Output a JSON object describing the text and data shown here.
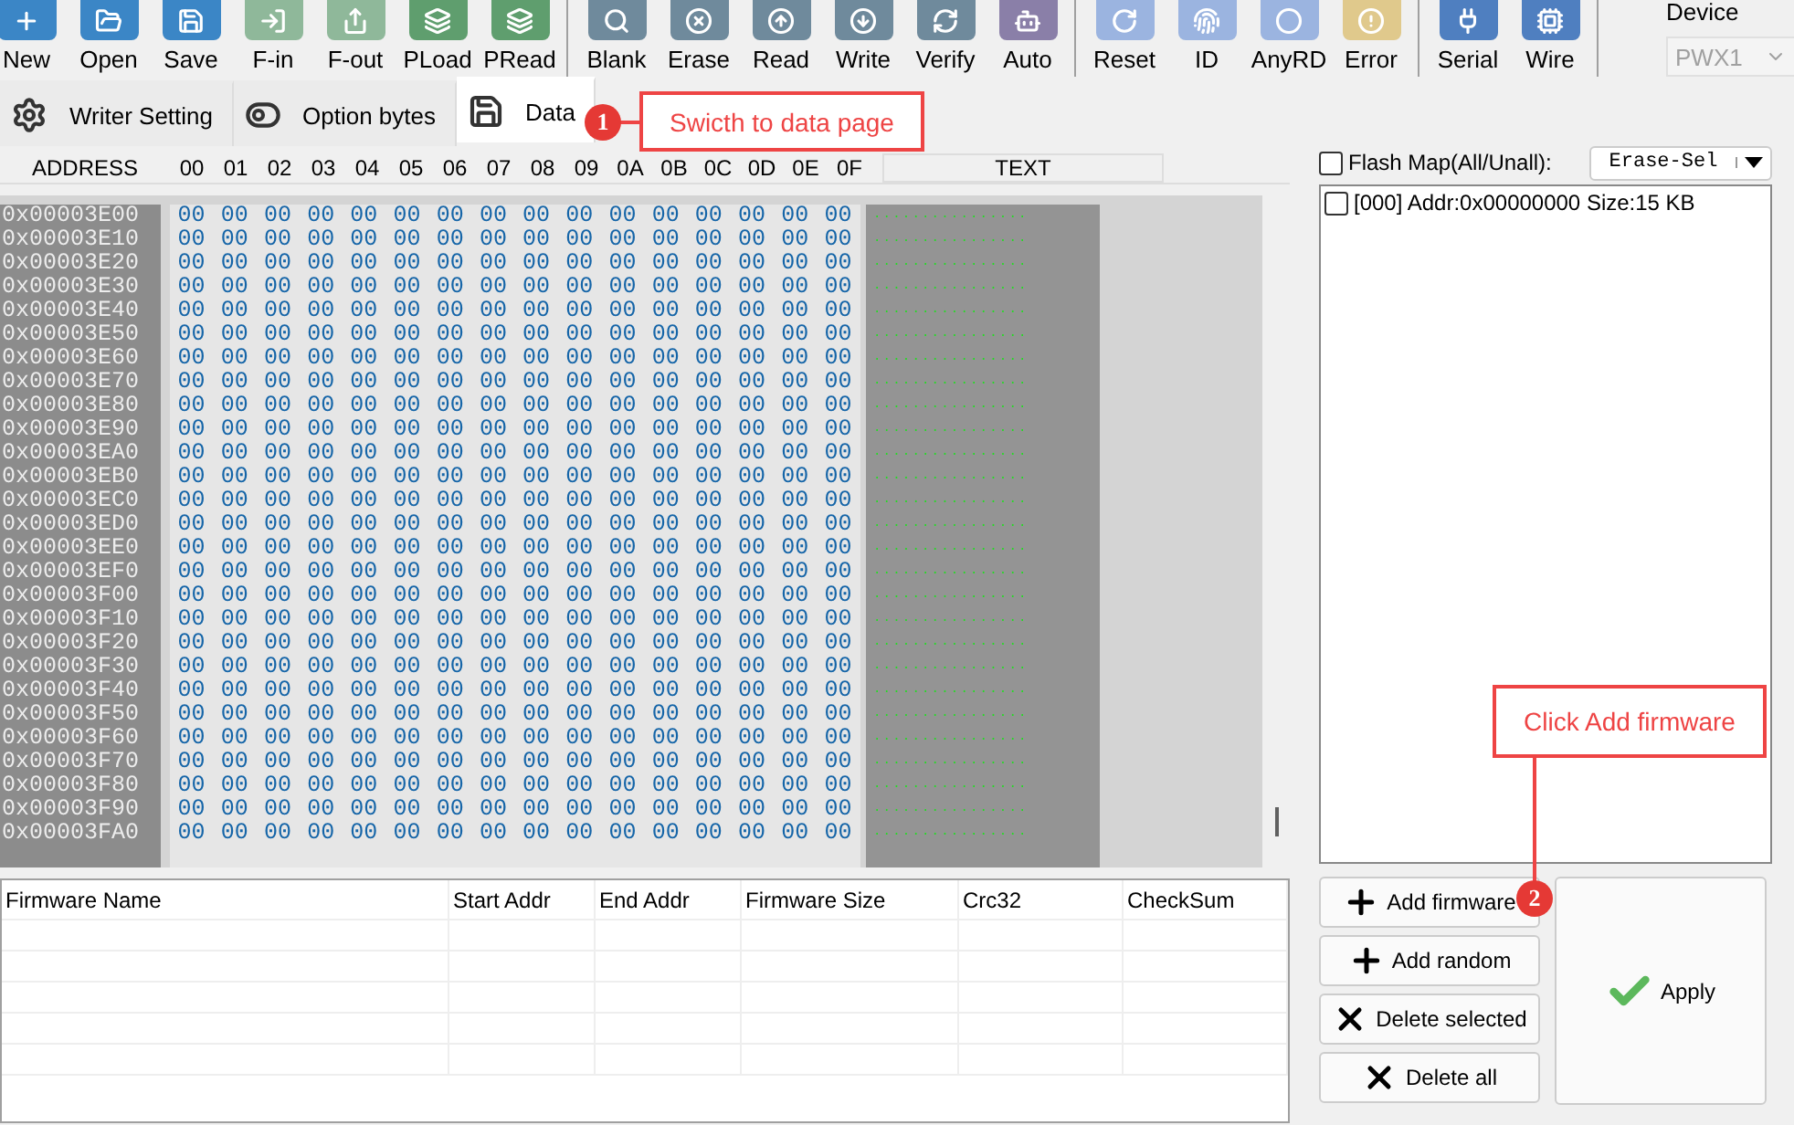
{
  "toolbar": {
    "groups": [
      [
        {
          "label": "New",
          "color": "#3b86c6"
        },
        {
          "label": "Open",
          "color": "#3b86c6"
        },
        {
          "label": "Save",
          "color": "#3b86c6"
        },
        {
          "label": "F-in",
          "color": "#8fb89a"
        },
        {
          "label": "F-out",
          "color": "#8fb89a"
        },
        {
          "label": "PLoad",
          "color": "#5f9e6e"
        },
        {
          "label": "PRead",
          "color": "#5f9e6e"
        }
      ],
      [
        {
          "label": "Blank",
          "color": "#6f8a9c"
        },
        {
          "label": "Erase",
          "color": "#6f8a9c"
        },
        {
          "label": "Read",
          "color": "#6f8a9c"
        },
        {
          "label": "Write",
          "color": "#6f8a9c"
        },
        {
          "label": "Verify",
          "color": "#6f8a9c"
        },
        {
          "label": "Auto",
          "color": "#8a7fa8"
        }
      ],
      [
        {
          "label": "Reset",
          "color": "#9bb4e0"
        },
        {
          "label": "ID",
          "color": "#9bb4e0"
        },
        {
          "label": "AnyRD",
          "color": "#9bb4e0"
        },
        {
          "label": "Error",
          "color": "#e0c98c"
        }
      ],
      [
        {
          "label": "Serial",
          "color": "#4f7fc0"
        },
        {
          "label": "Wire",
          "color": "#4f7fc0"
        }
      ]
    ],
    "device": {
      "label": "Device",
      "value": "PWX1",
      "disabled": true
    }
  },
  "tabs": [
    {
      "label": "Writer Setting",
      "selected": false
    },
    {
      "label": "Option bytes",
      "selected": false
    },
    {
      "label": "Data",
      "selected": true
    }
  ],
  "callouts": [
    {
      "number": "1",
      "text": "Swicth to data page"
    },
    {
      "number": "2",
      "text": "Click Add firmware"
    }
  ],
  "hex": {
    "columns": [
      "ADDRESS",
      "00",
      "01",
      "02",
      "03",
      "04",
      "05",
      "06",
      "07",
      "08",
      "09",
      "0A",
      "0B",
      "0C",
      "0D",
      "0E",
      "0F",
      "TEXT"
    ],
    "rows": [
      {
        "address": "0x00003E00",
        "bytes": [
          "00",
          "00",
          "00",
          "00",
          "00",
          "00",
          "00",
          "00",
          "00",
          "00",
          "00",
          "00",
          "00",
          "00",
          "00",
          "00"
        ],
        "text": "................"
      },
      {
        "address": "0x00003E10",
        "bytes": [
          "00",
          "00",
          "00",
          "00",
          "00",
          "00",
          "00",
          "00",
          "00",
          "00",
          "00",
          "00",
          "00",
          "00",
          "00",
          "00"
        ],
        "text": "................"
      },
      {
        "address": "0x00003E20",
        "bytes": [
          "00",
          "00",
          "00",
          "00",
          "00",
          "00",
          "00",
          "00",
          "00",
          "00",
          "00",
          "00",
          "00",
          "00",
          "00",
          "00"
        ],
        "text": "................"
      },
      {
        "address": "0x00003E30",
        "bytes": [
          "00",
          "00",
          "00",
          "00",
          "00",
          "00",
          "00",
          "00",
          "00",
          "00",
          "00",
          "00",
          "00",
          "00",
          "00",
          "00"
        ],
        "text": "................"
      },
      {
        "address": "0x00003E40",
        "bytes": [
          "00",
          "00",
          "00",
          "00",
          "00",
          "00",
          "00",
          "00",
          "00",
          "00",
          "00",
          "00",
          "00",
          "00",
          "00",
          "00"
        ],
        "text": "................"
      },
      {
        "address": "0x00003E50",
        "bytes": [
          "00",
          "00",
          "00",
          "00",
          "00",
          "00",
          "00",
          "00",
          "00",
          "00",
          "00",
          "00",
          "00",
          "00",
          "00",
          "00"
        ],
        "text": "................"
      },
      {
        "address": "0x00003E60",
        "bytes": [
          "00",
          "00",
          "00",
          "00",
          "00",
          "00",
          "00",
          "00",
          "00",
          "00",
          "00",
          "00",
          "00",
          "00",
          "00",
          "00"
        ],
        "text": "................"
      },
      {
        "address": "0x00003E70",
        "bytes": [
          "00",
          "00",
          "00",
          "00",
          "00",
          "00",
          "00",
          "00",
          "00",
          "00",
          "00",
          "00",
          "00",
          "00",
          "00",
          "00"
        ],
        "text": "................"
      },
      {
        "address": "0x00003E80",
        "bytes": [
          "00",
          "00",
          "00",
          "00",
          "00",
          "00",
          "00",
          "00",
          "00",
          "00",
          "00",
          "00",
          "00",
          "00",
          "00",
          "00"
        ],
        "text": "................"
      },
      {
        "address": "0x00003E90",
        "bytes": [
          "00",
          "00",
          "00",
          "00",
          "00",
          "00",
          "00",
          "00",
          "00",
          "00",
          "00",
          "00",
          "00",
          "00",
          "00",
          "00"
        ],
        "text": "................"
      },
      {
        "address": "0x00003EA0",
        "bytes": [
          "00",
          "00",
          "00",
          "00",
          "00",
          "00",
          "00",
          "00",
          "00",
          "00",
          "00",
          "00",
          "00",
          "00",
          "00",
          "00"
        ],
        "text": "................"
      },
      {
        "address": "0x00003EB0",
        "bytes": [
          "00",
          "00",
          "00",
          "00",
          "00",
          "00",
          "00",
          "00",
          "00",
          "00",
          "00",
          "00",
          "00",
          "00",
          "00",
          "00"
        ],
        "text": "................"
      },
      {
        "address": "0x00003EC0",
        "bytes": [
          "00",
          "00",
          "00",
          "00",
          "00",
          "00",
          "00",
          "00",
          "00",
          "00",
          "00",
          "00",
          "00",
          "00",
          "00",
          "00"
        ],
        "text": "................"
      },
      {
        "address": "0x00003ED0",
        "bytes": [
          "00",
          "00",
          "00",
          "00",
          "00",
          "00",
          "00",
          "00",
          "00",
          "00",
          "00",
          "00",
          "00",
          "00",
          "00",
          "00"
        ],
        "text": "................"
      },
      {
        "address": "0x00003EE0",
        "bytes": [
          "00",
          "00",
          "00",
          "00",
          "00",
          "00",
          "00",
          "00",
          "00",
          "00",
          "00",
          "00",
          "00",
          "00",
          "00",
          "00"
        ],
        "text": "................"
      },
      {
        "address": "0x00003EF0",
        "bytes": [
          "00",
          "00",
          "00",
          "00",
          "00",
          "00",
          "00",
          "00",
          "00",
          "00",
          "00",
          "00",
          "00",
          "00",
          "00",
          "00"
        ],
        "text": "................"
      },
      {
        "address": "0x00003F00",
        "bytes": [
          "00",
          "00",
          "00",
          "00",
          "00",
          "00",
          "00",
          "00",
          "00",
          "00",
          "00",
          "00",
          "00",
          "00",
          "00",
          "00"
        ],
        "text": "................"
      },
      {
        "address": "0x00003F10",
        "bytes": [
          "00",
          "00",
          "00",
          "00",
          "00",
          "00",
          "00",
          "00",
          "00",
          "00",
          "00",
          "00",
          "00",
          "00",
          "00",
          "00"
        ],
        "text": "................"
      },
      {
        "address": "0x00003F20",
        "bytes": [
          "00",
          "00",
          "00",
          "00",
          "00",
          "00",
          "00",
          "00",
          "00",
          "00",
          "00",
          "00",
          "00",
          "00",
          "00",
          "00"
        ],
        "text": "................"
      },
      {
        "address": "0x00003F30",
        "bytes": [
          "00",
          "00",
          "00",
          "00",
          "00",
          "00",
          "00",
          "00",
          "00",
          "00",
          "00",
          "00",
          "00",
          "00",
          "00",
          "00"
        ],
        "text": "................"
      },
      {
        "address": "0x00003F40",
        "bytes": [
          "00",
          "00",
          "00",
          "00",
          "00",
          "00",
          "00",
          "00",
          "00",
          "00",
          "00",
          "00",
          "00",
          "00",
          "00",
          "00"
        ],
        "text": "................"
      },
      {
        "address": "0x00003F50",
        "bytes": [
          "00",
          "00",
          "00",
          "00",
          "00",
          "00",
          "00",
          "00",
          "00",
          "00",
          "00",
          "00",
          "00",
          "00",
          "00",
          "00"
        ],
        "text": "................"
      },
      {
        "address": "0x00003F60",
        "bytes": [
          "00",
          "00",
          "00",
          "00",
          "00",
          "00",
          "00",
          "00",
          "00",
          "00",
          "00",
          "00",
          "00",
          "00",
          "00",
          "00"
        ],
        "text": "................"
      },
      {
        "address": "0x00003F70",
        "bytes": [
          "00",
          "00",
          "00",
          "00",
          "00",
          "00",
          "00",
          "00",
          "00",
          "00",
          "00",
          "00",
          "00",
          "00",
          "00",
          "00"
        ],
        "text": "................"
      },
      {
        "address": "0x00003F80",
        "bytes": [
          "00",
          "00",
          "00",
          "00",
          "00",
          "00",
          "00",
          "00",
          "00",
          "00",
          "00",
          "00",
          "00",
          "00",
          "00",
          "00"
        ],
        "text": "................"
      },
      {
        "address": "0x00003F90",
        "bytes": [
          "00",
          "00",
          "00",
          "00",
          "00",
          "00",
          "00",
          "00",
          "00",
          "00",
          "00",
          "00",
          "00",
          "00",
          "00",
          "00"
        ],
        "text": "................"
      },
      {
        "address": "0x00003FA0",
        "bytes": [
          "00",
          "00",
          "00",
          "00",
          "00",
          "00",
          "00",
          "00",
          "00",
          "00",
          "00",
          "00",
          "00",
          "00",
          "00",
          "00"
        ],
        "text": "................"
      }
    ]
  },
  "flash_map": {
    "label": "Flash Map(All/Unall):",
    "checked": false,
    "mode": "Erase-Sel",
    "items": [
      {
        "label": "[000] Addr:0x00000000 Size:15 KB",
        "checked": false
      }
    ]
  },
  "firmware_table": {
    "columns": [
      "Firmware Name",
      "Start Addr",
      "End Addr",
      "Firmware Size",
      "Crc32",
      "CheckSum"
    ]
  },
  "actions": [
    {
      "label": "Add firmware",
      "kind": "add"
    },
    {
      "label": "Add random",
      "kind": "add"
    },
    {
      "label": "Delete selected",
      "kind": "delete"
    },
    {
      "label": "Delete all",
      "kind": "delete"
    }
  ],
  "apply": {
    "label": "Apply"
  }
}
